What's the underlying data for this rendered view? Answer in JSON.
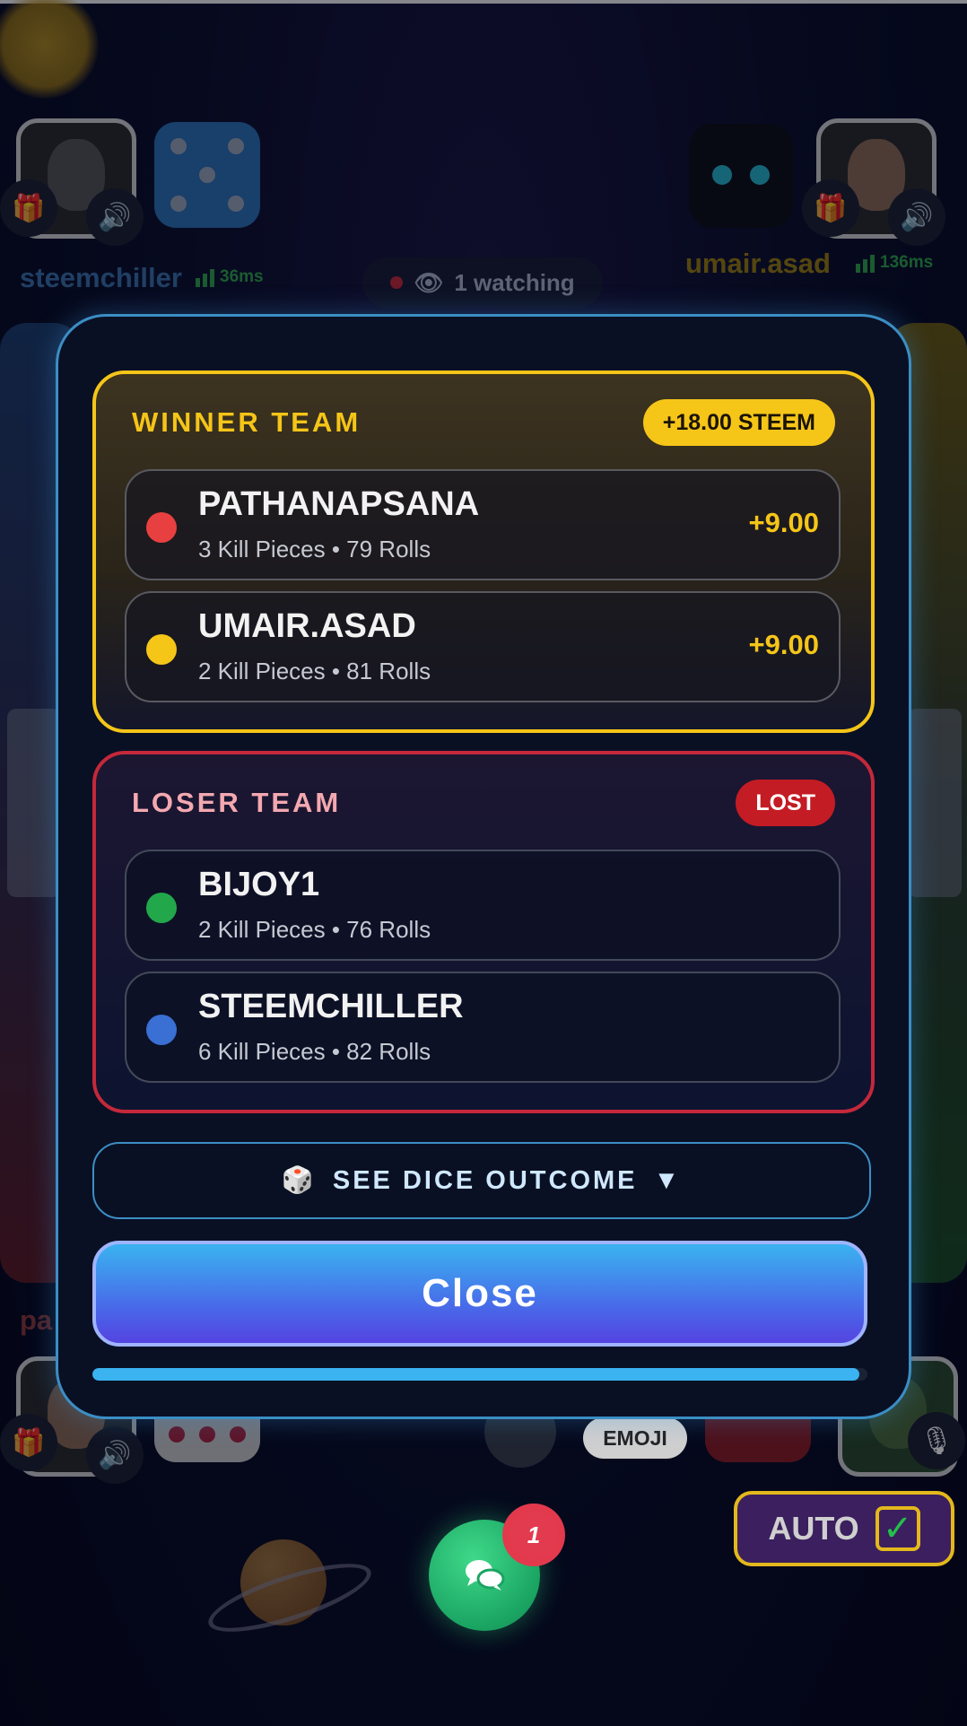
{
  "players_top": {
    "left_name": "steemchiller",
    "left_ping": "36ms",
    "right_name": "umair.asad",
    "right_ping": "136ms"
  },
  "watching": {
    "icon": "eye-icon",
    "label": "1 watching"
  },
  "modal": {
    "winner": {
      "title": "WINNER TEAM",
      "total": "+18.00 STEEM",
      "players": [
        {
          "name": "PATHANAPSANA",
          "stats": "3 Kill Pieces • 79 Rolls",
          "amount": "+9.00",
          "color": "#e84040"
        },
        {
          "name": "UMAIR.ASAD",
          "stats": "2 Kill Pieces • 81 Rolls",
          "amount": "+9.00",
          "color": "#f5c518"
        }
      ]
    },
    "loser": {
      "title": "LOSER TEAM",
      "status": "LOST",
      "players": [
        {
          "name": "BIJOY1",
          "stats": "2 Kill Pieces • 76 Rolls",
          "color": "#22a84a"
        },
        {
          "name": "STEEMCHILLER",
          "stats": "6 Kill Pieces • 82 Rolls",
          "color": "#3a6fd4"
        }
      ]
    },
    "dice_outcome": {
      "icon": "dice-icon",
      "label": "SEE DICE OUTCOME",
      "chevron": "▼"
    },
    "close_label": "Close",
    "progress": 0.99
  },
  "bottom": {
    "emoji_label": "EMOJI",
    "chat_notification_count": "1",
    "auto_label": "AUTO",
    "auto_checked": true,
    "partial_name": "pa"
  }
}
